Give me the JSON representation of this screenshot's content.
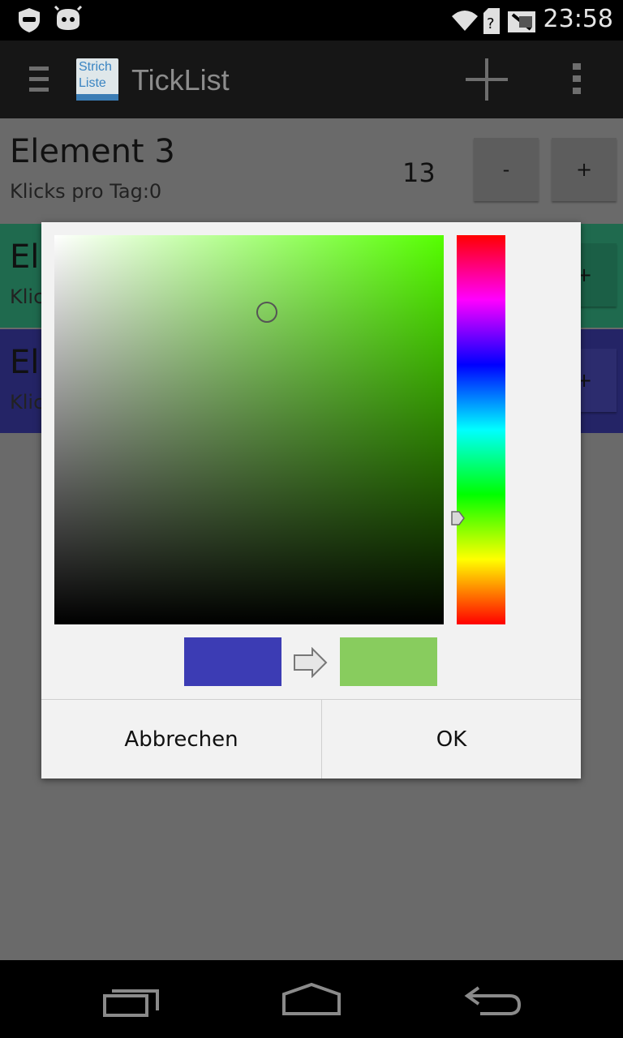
{
  "status_bar": {
    "time": "23:58"
  },
  "app": {
    "title": "TickList",
    "logo_line1": "Strich",
    "logo_line2": "Liste"
  },
  "list": {
    "items": [
      {
        "title": "Element 3",
        "subtitle": "Klicks pro Tag:0",
        "count": "13",
        "minus": "-",
        "plus": "+",
        "color": "#6a6a6a"
      },
      {
        "title": "El",
        "subtitle": "Klic",
        "plus": "+",
        "color": "#1f6a4e"
      },
      {
        "title": "El",
        "subtitle": "Klic",
        "plus": "+",
        "color": "#242466"
      }
    ]
  },
  "dialog": {
    "cancel_label": "Abbrechen",
    "ok_label": "OK",
    "old_color": "#3c3cb4",
    "new_color": "#88cc5e"
  },
  "icons": [
    "menu-icon",
    "add-icon",
    "overflow-icon",
    "back-icon",
    "home-icon",
    "recents-icon",
    "wifi-icon",
    "battery-icon",
    "arrow-right-icon"
  ]
}
